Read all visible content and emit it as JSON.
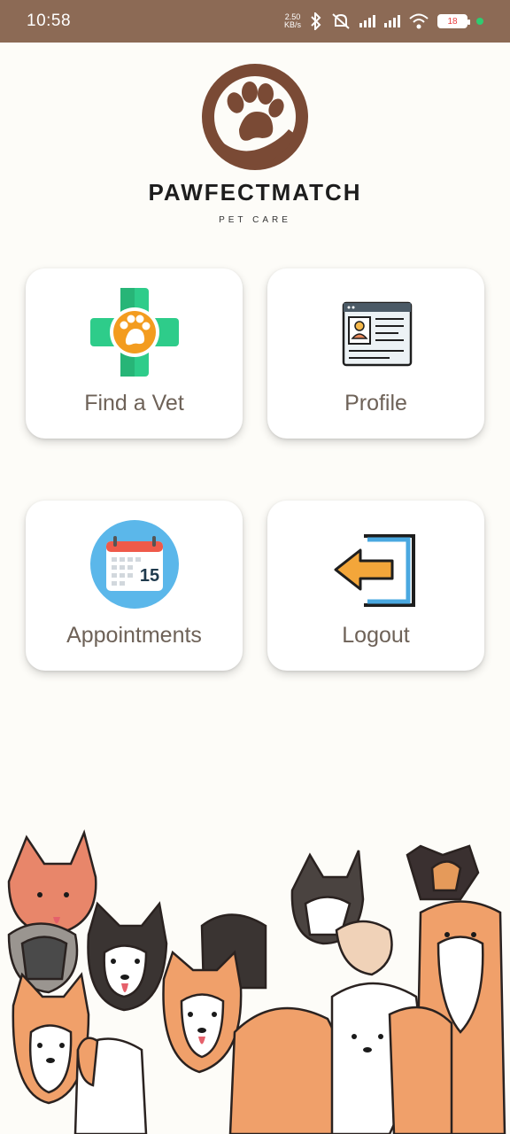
{
  "status_bar": {
    "time": "10:58",
    "net_speed_value": "2.50",
    "net_speed_unit": "KB/s",
    "battery": "18"
  },
  "logo": {
    "title": "PAWFECTMATCH",
    "subtitle": "PET CARE"
  },
  "menu": {
    "find_vet": "Find a Vet",
    "profile": "Profile",
    "appointments": "Appointments",
    "logout": "Logout",
    "calendar_day": "15"
  },
  "colors": {
    "status_bar": "#8c6a55",
    "logo_brown": "#7a4a35",
    "cross_green": "#2ecc8a",
    "paw_orange": "#f39c1f",
    "calendar_blue": "#5bb7ea",
    "logout_blue": "#4aa8e0"
  }
}
